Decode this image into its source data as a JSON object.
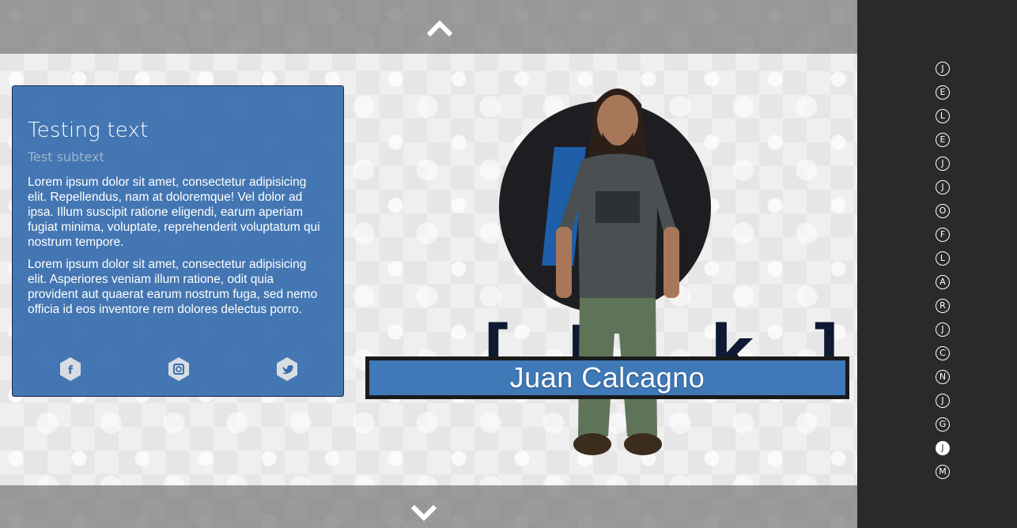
{
  "card": {
    "title": "Testing text",
    "subtitle": "Test subtext",
    "paragraphs": [
      "Lorem ipsum dolor sit amet, consectetur adipisicing elit. Repellendus, nam at doloremque! Vel dolor ad ipsa. Illum suscipit ratione eligendi, earum aperiam fugiat minima, voluptate, reprehenderit voluptatum qui nostrum tempore.",
      "Lorem ipsum dolor sit amet, consectetur adipisicing elit. Asperiores veniam illum ratione, odit quia provident aut quaerat earum nostrum fuga, sed nemo officia id eos inventore rem dolores delectus porro."
    ],
    "social": [
      {
        "icon": "facebook-icon",
        "glyph": "f"
      },
      {
        "icon": "instagram-icon",
        "glyph": "◘"
      },
      {
        "icon": "twitter-icon",
        "glyph": "✈"
      }
    ]
  },
  "profile": {
    "name": "Juan Calcagno"
  },
  "sidebar": {
    "letters": [
      "J",
      "E",
      "L",
      "E",
      "J",
      "J",
      "O",
      "F",
      "L",
      "A",
      "R",
      "J",
      "C",
      "N",
      "J",
      "G",
      "J",
      "M"
    ],
    "active_index": 16
  },
  "colors": {
    "accent": "#3f79b8",
    "card": "#366dad",
    "sidebar": "#2a2a2a"
  }
}
